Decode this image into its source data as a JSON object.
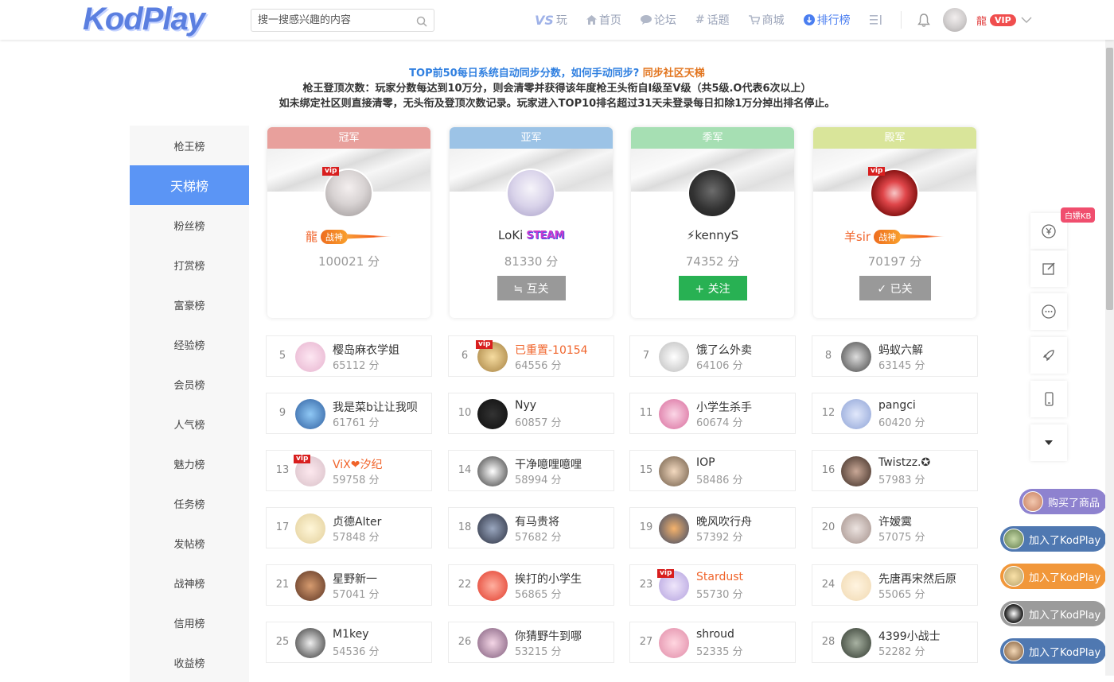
{
  "header": {
    "logo": "KodPlay",
    "search_placeholder": "搜一搜感兴趣的内容",
    "nav": [
      {
        "label": "玩",
        "prefix": "VS",
        "icon": "vs-icon"
      },
      {
        "label": "首页",
        "icon": "home-icon"
      },
      {
        "label": "论坛",
        "icon": "chat-icon"
      },
      {
        "label": "话题",
        "icon": "hash-icon"
      },
      {
        "label": "商城",
        "icon": "cart-icon"
      },
      {
        "label": "排行榜",
        "icon": "rank-icon"
      }
    ],
    "user": {
      "name": "龍",
      "vip": "VIP"
    }
  },
  "notice": {
    "line1_blue": "TOP前50每日系统自动同步分数，如何手动同步?",
    "line1_orange": "同步社区天梯",
    "line2": "枪王登顶次数：玩家分数每达到10万分，则会清零并获得该年度枪王头衔自I级至V级（共5级.O代表6次以上）",
    "line3": "如未绑定社区则直接清零，无头衔及登顶次数记录。玩家进入TOP10排名超过31天未登录每日扣除1万分掉出排名停止。"
  },
  "sidebar": {
    "items": [
      "枪王榜",
      "天梯榜",
      "粉丝榜",
      "打赏榜",
      "富豪榜",
      "经验榜",
      "会员榜",
      "人气榜",
      "魅力榜",
      "任务榜",
      "发帖榜",
      "战神榜",
      "信用榜",
      "收益榜"
    ],
    "active_index": 1
  },
  "podium": [
    {
      "rank_label": "冠军",
      "name": "龍",
      "score": "100021 分",
      "badge": "战神",
      "vip": "vip",
      "button": "",
      "bar_color": "#e8a09c"
    },
    {
      "rank_label": "亚军",
      "name": "LoKi",
      "tag": "STEAM",
      "score": "81330 分",
      "badge": "",
      "vip": "",
      "button": "≒ 互关",
      "bar_color": "#9cc3e6"
    },
    {
      "rank_label": "季军",
      "name": "⚡kennyS",
      "score": "74352 分",
      "badge": "",
      "vip": "",
      "button": "+ 关注",
      "bar_color": "#a6dfb3"
    },
    {
      "rank_label": "殿军",
      "name": "羊sir",
      "score": "70197 分",
      "badge": "战神",
      "vip": "vip",
      "button": "✓ 已关",
      "bar_color": "#d9e59a"
    }
  ],
  "ranking": [
    {
      "rank": "5",
      "name": "樱岛麻衣学姐",
      "score": "65112 分",
      "red": false,
      "vip": false
    },
    {
      "rank": "6",
      "name": "已重置-10154",
      "score": "64556 分",
      "red": true,
      "vip": true
    },
    {
      "rank": "7",
      "name": "饿了么外卖",
      "score": "64106 分",
      "red": false,
      "vip": false
    },
    {
      "rank": "8",
      "name": "蚂蚁六解",
      "score": "63145 分",
      "red": false,
      "vip": false
    },
    {
      "rank": "9",
      "name": "我是菜b让让我呗",
      "score": "61761 分",
      "red": false,
      "vip": false
    },
    {
      "rank": "10",
      "name": "Nyy",
      "score": "60857 分",
      "red": false,
      "vip": false
    },
    {
      "rank": "11",
      "name": "小学生杀手",
      "score": "60674 分",
      "red": false,
      "vip": false
    },
    {
      "rank": "12",
      "name": "pangci",
      "score": "60420 分",
      "red": false,
      "vip": false
    },
    {
      "rank": "13",
      "name": "ViX❤汐纪",
      "score": "59758 分",
      "red": true,
      "vip": true
    },
    {
      "rank": "14",
      "name": "干净噫哩噫哩",
      "score": "58994 分",
      "red": false,
      "vip": false
    },
    {
      "rank": "15",
      "name": "IOP",
      "score": "58486 分",
      "red": false,
      "vip": false
    },
    {
      "rank": "16",
      "name": "Twistzz.✪",
      "score": "57983 分",
      "red": false,
      "vip": false
    },
    {
      "rank": "17",
      "name": "贞德Alter",
      "score": "57848 分",
      "red": false,
      "vip": false
    },
    {
      "rank": "18",
      "name": "有马贵将",
      "score": "57682 分",
      "red": false,
      "vip": false
    },
    {
      "rank": "19",
      "name": "晚风吹行舟",
      "score": "57392 分",
      "red": false,
      "vip": false
    },
    {
      "rank": "20",
      "name": "许嫒霙",
      "score": "57075 分",
      "red": false,
      "vip": false
    },
    {
      "rank": "21",
      "name": "星野新一",
      "score": "57041 分",
      "red": false,
      "vip": false
    },
    {
      "rank": "22",
      "name": "挨打的小学生",
      "score": "56865 分",
      "red": false,
      "vip": false
    },
    {
      "rank": "23",
      "name": "Stardust",
      "score": "55730 分",
      "red": true,
      "vip": true
    },
    {
      "rank": "24",
      "name": "先唐再宋然后原",
      "score": "55065 分",
      "red": false,
      "vip": false
    },
    {
      "rank": "25",
      "name": "M1key",
      "score": "54536 分",
      "red": false,
      "vip": false
    },
    {
      "rank": "26",
      "name": "你猜野牛到哪",
      "score": "53215 分",
      "red": false,
      "vip": false
    },
    {
      "rank": "27",
      "name": "shroud",
      "score": "52335 分",
      "red": false,
      "vip": false
    },
    {
      "rank": "28",
      "name": "4399小战士",
      "score": "52282 分",
      "red": false,
      "vip": false
    }
  ],
  "right_tools": {
    "kb_badge": "白嫖KB",
    "icons": [
      "yen-icon",
      "edit-icon",
      "message-icon",
      "rocket-icon",
      "mobile-icon",
      "caret-down-icon"
    ]
  },
  "activity": [
    {
      "text": "购买了商品",
      "color": "#8e82cf"
    },
    {
      "text": "加入了KodPlay",
      "color": "#4f78b1"
    },
    {
      "text": "加入了KodPlay",
      "color": "#f1973a"
    },
    {
      "text": "加入了KodPlay",
      "color": "#9b9b9b"
    },
    {
      "text": "加入了KodPlay",
      "color": "#4f78b1"
    }
  ]
}
